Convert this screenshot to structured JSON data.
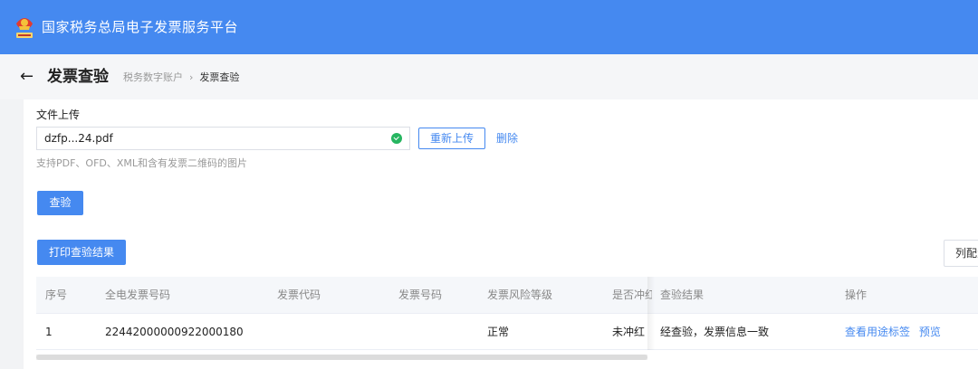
{
  "header": {
    "site_title": "国家税务总局电子发票服务平台"
  },
  "page": {
    "back_glyph": "←",
    "title": "发票查验",
    "breadcrumb": {
      "parent": "税务数字账户",
      "separator": "›",
      "current": "发票查验"
    }
  },
  "upload": {
    "label": "文件上传",
    "file_name": "dzfp...24.pdf",
    "reupload_label": "重新上传",
    "delete_label": "删除",
    "hint": "支持PDF、OFD、XML和含有发票二维码的图片"
  },
  "actions": {
    "verify_label": "查验",
    "print_label": "打印查验结果",
    "column_config_label": "列配置"
  },
  "table": {
    "columns": [
      "序号",
      "全电发票号码",
      "发票代码",
      "发票号码",
      "发票风险等级",
      "是否冲红",
      "查验结果",
      "操作"
    ],
    "rows": [
      {
        "index": "1",
        "invoice_full_number": "22442000000922000180",
        "invoice_code": "",
        "invoice_number": "",
        "risk_level": "正常",
        "is_reversed": "未冲红",
        "result": "经查验，发票信息一致",
        "actions": [
          "查看用途标签",
          "预览"
        ]
      }
    ]
  },
  "colors": {
    "brand_blue": "#4589f0",
    "success_green": "#26b560"
  },
  "icons": {
    "logo": "tax-emblem-icon",
    "file_status": "check-circle-icon"
  }
}
